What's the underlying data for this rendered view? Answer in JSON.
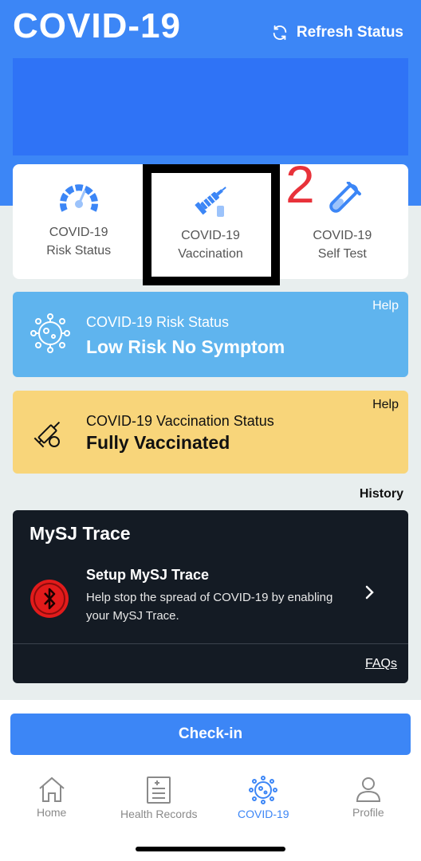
{
  "header": {
    "title": "COVID-19",
    "refresh_label": "Refresh Status"
  },
  "quick_actions": [
    {
      "line1": "COVID-19",
      "line2": "Risk Status",
      "icon": "gauge-icon"
    },
    {
      "line1": "COVID-19",
      "line2": "Vaccination",
      "icon": "syringe-icon"
    },
    {
      "line1": "COVID-19",
      "line2": "Self Test",
      "icon": "test-tube-icon"
    }
  ],
  "annotation": {
    "number": "2"
  },
  "risk_card": {
    "help": "Help",
    "title": "COVID-19 Risk Status",
    "value": "Low Risk No Symptom"
  },
  "vaccination_card": {
    "help": "Help",
    "title": "COVID-19 Vaccination Status",
    "value": "Fully Vaccinated"
  },
  "history_label": "History",
  "trace": {
    "title": "MySJ Trace",
    "row_title": "Setup MySJ Trace",
    "row_desc": "Help stop the spread of COVID-19 by enabling your MySJ Trace.",
    "faqs": "FAQs"
  },
  "checkin_label": "Check-in",
  "nav": [
    {
      "label": "Home",
      "icon": "home-icon"
    },
    {
      "label": "Health Records",
      "icon": "health-records-icon"
    },
    {
      "label": "COVID-19",
      "icon": "virus-icon",
      "active": true
    },
    {
      "label": "Profile",
      "icon": "profile-icon"
    }
  ],
  "colors": {
    "primary": "#3c86f6",
    "risk_card": "#5fb4ee",
    "vaccination_card": "#f8d57a",
    "trace_card": "#141b24",
    "annotation": "#e8323a"
  }
}
